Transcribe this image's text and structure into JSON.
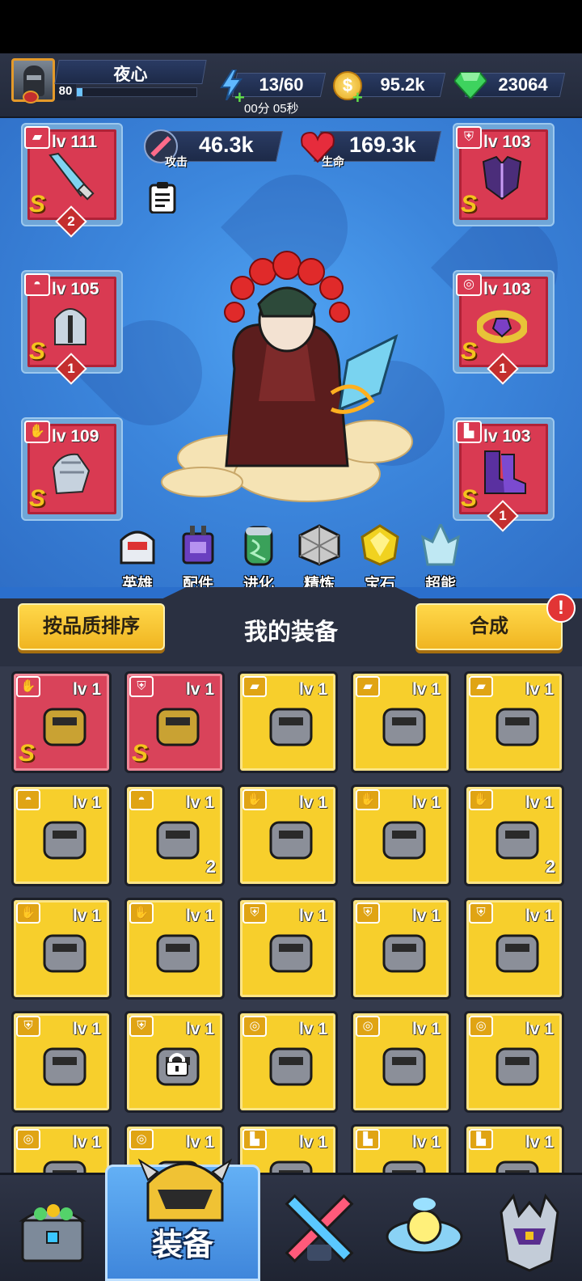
{
  "header": {
    "player_name": "夜心",
    "player_level": "80",
    "xp_fraction": 0.05,
    "energy": "13/60",
    "energy_timer": "00分 05秒",
    "gold": "95.2k",
    "gems": "23064"
  },
  "hero": {
    "attack_value": "46.3k",
    "attack_label": "攻击",
    "hp_value": "169.3k",
    "hp_label": "生命",
    "left_slots": [
      {
        "level": "lv 111",
        "grade": "S",
        "count": "2",
        "icon": "dagger-icon"
      },
      {
        "level": "lv 105",
        "grade": "S",
        "count": "1",
        "icon": "knight-helmet-icon"
      },
      {
        "level": "lv 109",
        "grade": "S",
        "count": "",
        "icon": "gauntlet-icon"
      }
    ],
    "right_slots": [
      {
        "level": "lv 103",
        "grade": "S",
        "count": "",
        "icon": "armor-icon"
      },
      {
        "level": "lv 103",
        "grade": "S",
        "count": "1",
        "icon": "belt-icon"
      },
      {
        "level": "lv 103",
        "grade": "S",
        "count": "1",
        "icon": "boots-icon"
      }
    ],
    "nav": [
      {
        "label": "英雄",
        "icon": "hero-icon"
      },
      {
        "label": "配件",
        "icon": "parts-icon"
      },
      {
        "label": "进化",
        "icon": "evolve-icon"
      },
      {
        "label": "精炼",
        "icon": "refine-icon"
      },
      {
        "label": "宝石",
        "icon": "gem-stone-icon"
      },
      {
        "label": "超能",
        "icon": "crystal-icon"
      }
    ]
  },
  "sortbar": {
    "sort_label": "按品质排序",
    "title": "我的装备",
    "merge_label": "合成",
    "alert": "!"
  },
  "inventory": {
    "items": [
      {
        "quality": "red",
        "level": "lv 1",
        "grade": "S",
        "count": "",
        "icon": "gold-gauntlet-icon"
      },
      {
        "quality": "red",
        "level": "lv 1",
        "grade": "S",
        "count": "",
        "icon": "silver-armor-icon"
      },
      {
        "quality": "yellow",
        "level": "lv 1",
        "grade": "",
        "count": "",
        "icon": "blaster-icon"
      },
      {
        "quality": "yellow",
        "level": "lv 1",
        "grade": "",
        "count": "",
        "icon": "cannon-icon"
      },
      {
        "quality": "yellow",
        "level": "lv 1",
        "grade": "",
        "count": "",
        "icon": "sword-icon"
      },
      {
        "quality": "yellow",
        "level": "lv 1",
        "grade": "",
        "count": "",
        "icon": "gold-helmet-icon"
      },
      {
        "quality": "yellow",
        "level": "lv 1",
        "grade": "",
        "count": "2",
        "icon": "red-helmet-icon"
      },
      {
        "quality": "yellow",
        "level": "lv 1",
        "grade": "",
        "count": "",
        "icon": "dark-glove-icon"
      },
      {
        "quality": "yellow",
        "level": "lv 1",
        "grade": "",
        "count": "",
        "icon": "bronze-glove-icon"
      },
      {
        "quality": "yellow",
        "level": "lv 1",
        "grade": "",
        "count": "2",
        "icon": "gold-glove-icon"
      },
      {
        "quality": "yellow",
        "level": "lv 1",
        "grade": "",
        "count": "",
        "icon": "white-glove-icon"
      },
      {
        "quality": "yellow",
        "level": "lv 1",
        "grade": "",
        "count": "",
        "icon": "steel-glove-icon"
      },
      {
        "quality": "yellow",
        "level": "lv 1",
        "grade": "",
        "count": "",
        "icon": "red-armor-icon"
      },
      {
        "quality": "yellow",
        "level": "lv 1",
        "grade": "",
        "count": "",
        "icon": "bronze-armor-icon"
      },
      {
        "quality": "yellow",
        "level": "lv 1",
        "grade": "",
        "count": "",
        "icon": "white-armor-icon"
      },
      {
        "quality": "yellow",
        "level": "lv 1",
        "grade": "",
        "count": "",
        "icon": "gold-vest-icon"
      },
      {
        "quality": "yellow",
        "level": "lv 1",
        "grade": "",
        "count": "",
        "icon": "locked-armor-icon",
        "locked": true
      },
      {
        "quality": "yellow",
        "level": "lv 1",
        "grade": "",
        "count": "",
        "icon": "red-belt-icon"
      },
      {
        "quality": "yellow",
        "level": "lv 1",
        "grade": "",
        "count": "",
        "icon": "bronze-belt-icon"
      },
      {
        "quality": "yellow",
        "level": "lv 1",
        "grade": "",
        "count": "",
        "icon": "blue-belt-icon"
      },
      {
        "quality": "yellow",
        "level": "lv 1",
        "grade": "",
        "count": "",
        "icon": "belt-icon"
      },
      {
        "quality": "yellow",
        "level": "lv 1",
        "grade": "",
        "count": "",
        "icon": "belt-icon"
      },
      {
        "quality": "yellow",
        "level": "lv 1",
        "grade": "",
        "count": "",
        "icon": "boots-icon"
      },
      {
        "quality": "yellow",
        "level": "lv 1",
        "grade": "",
        "count": "",
        "icon": "boots-icon"
      },
      {
        "quality": "yellow",
        "level": "lv 1",
        "grade": "",
        "count": "",
        "icon": "boots-icon"
      }
    ]
  },
  "bottom_nav": {
    "active_label": "装备",
    "tabs": [
      {
        "icon": "treasure-chest-icon"
      },
      {
        "icon": "equipment-helmet-icon"
      },
      {
        "icon": "crossed-swords-icon"
      },
      {
        "icon": "ufo-icon"
      },
      {
        "icon": "horned-helmet-icon"
      }
    ]
  },
  "colors": {
    "red_quality": "#d9435a",
    "yellow_quality": "#f7cf2c",
    "accent_blue": "#3c86dc"
  }
}
